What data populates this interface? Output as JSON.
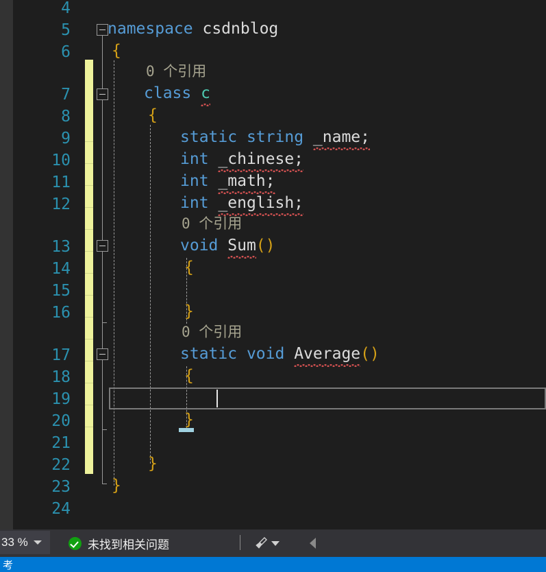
{
  "editor": {
    "background_color": "#1e1e1e",
    "line_number_color": "#2b91af",
    "change_bar_color": "#eef29c",
    "keyword_color": "#569cd6",
    "type_color": "#4ec9b0",
    "identifier_color": "#dcdcdc",
    "brace_color": "#d4a017",
    "codelens_color": "#a6a48f",
    "lines": [
      {
        "number": "4",
        "code": ""
      },
      {
        "number": "5",
        "code": "namespace csdnblog"
      },
      {
        "number": "6",
        "code": "{"
      },
      {
        "number": "7",
        "code": "class c"
      },
      {
        "number": "8",
        "code": "{"
      },
      {
        "number": "9",
        "code": "static string _name;"
      },
      {
        "number": "10",
        "code": "int _chinese;"
      },
      {
        "number": "11",
        "code": "int _math;"
      },
      {
        "number": "12",
        "code": "int _english;"
      },
      {
        "number": "13",
        "code": "void Sum()"
      },
      {
        "number": "14",
        "code": "{"
      },
      {
        "number": "15",
        "code": ""
      },
      {
        "number": "16",
        "code": "}"
      },
      {
        "number": "17",
        "code": "static void Average()"
      },
      {
        "number": "18",
        "code": "{"
      },
      {
        "number": "19",
        "code": ""
      },
      {
        "number": "20",
        "code": "}"
      },
      {
        "number": "21",
        "code": ""
      },
      {
        "number": "22",
        "code": "}"
      },
      {
        "number": "23",
        "code": "}"
      },
      {
        "number": "24",
        "code": ""
      }
    ],
    "tokens": {
      "kw_namespace": "namespace",
      "name_csdnblog": "csdnblog",
      "brace_open": "{",
      "brace_close": "}",
      "kw_class": "class",
      "type_c": "c",
      "kw_static": "static",
      "kw_string": "string",
      "ident_name": "_name;",
      "kw_int": "int",
      "ident_chinese": "_chinese;",
      "ident_math": "_math;",
      "ident_english": "_english;",
      "kw_void": "void",
      "ident_sum": "Sum",
      "parens": "()",
      "ident_average": "Average"
    },
    "codelens": {
      "references_label": "0 个引用"
    }
  },
  "statusbar": {
    "zoom_level": "33 %",
    "issue_status": "未找到相关问题",
    "zoom_dropdown_icon": "chevron-down-icon",
    "ok_icon": "check-circle-icon",
    "broom_icon": "broom-icon",
    "broom_dropdown_icon": "chevron-down-icon",
    "back_icon": "arrow-left-icon"
  },
  "taskbar": {
    "glyph": "考",
    "color": "#0078d4"
  }
}
